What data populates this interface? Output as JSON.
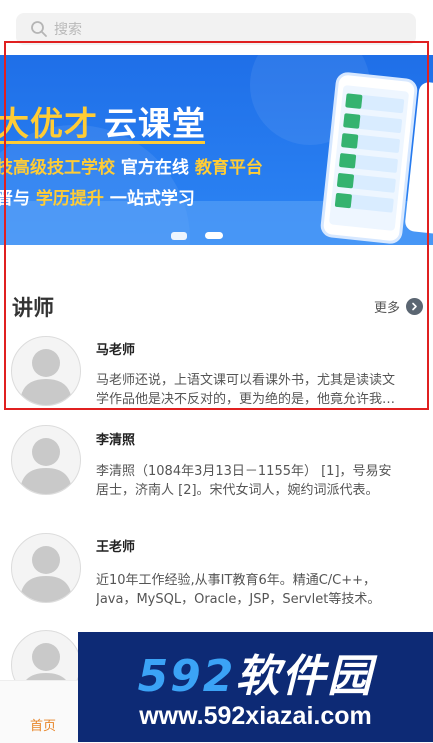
{
  "search": {
    "placeholder": "搜索"
  },
  "banner": {
    "title_highlight": "大优才",
    "title_rest": "云课堂",
    "line2_highlight": "技高级技工学校",
    "line2_mid": "官方在线",
    "line2_end": "教育平台",
    "line3_start": "晋与",
    "line3_highlight": "学历提升",
    "line3_end": "一站式学习",
    "slide_count": 2,
    "active_slide": 2
  },
  "teachers_section": {
    "title": "讲师",
    "more_label": "更多"
  },
  "teachers": [
    {
      "name": "马老师",
      "desc": "马老师还说，上语文课可以看课外书，尤其是读读文学作品他是决不反对的，更为绝的是，他竟允许我们上课时看武侠小说。"
    },
    {
      "name": "李清照",
      "desc": "李清照（1084年3月13日－1155年） [1]，号易安居士，济南人 [2]。宋代女词人，婉约词派代表。"
    },
    {
      "name": "王老师",
      "desc": "近10年工作经验,从事IT教育6年。精通C/C++，Java，MySQL，Oracle，JSP，Servlet等技术。"
    },
    {
      "name": "",
      "desc": ""
    }
  ],
  "tabbar": {
    "home_label": "首页"
  },
  "watermark": {
    "number": "592",
    "text": "软件园",
    "url": "www.592xiazai.com"
  },
  "colors": {
    "accent": "#e8862a",
    "banner_blue": "#1f6fe8",
    "highlight_yellow": "#ffcc35",
    "annotation_red": "#e02020"
  }
}
